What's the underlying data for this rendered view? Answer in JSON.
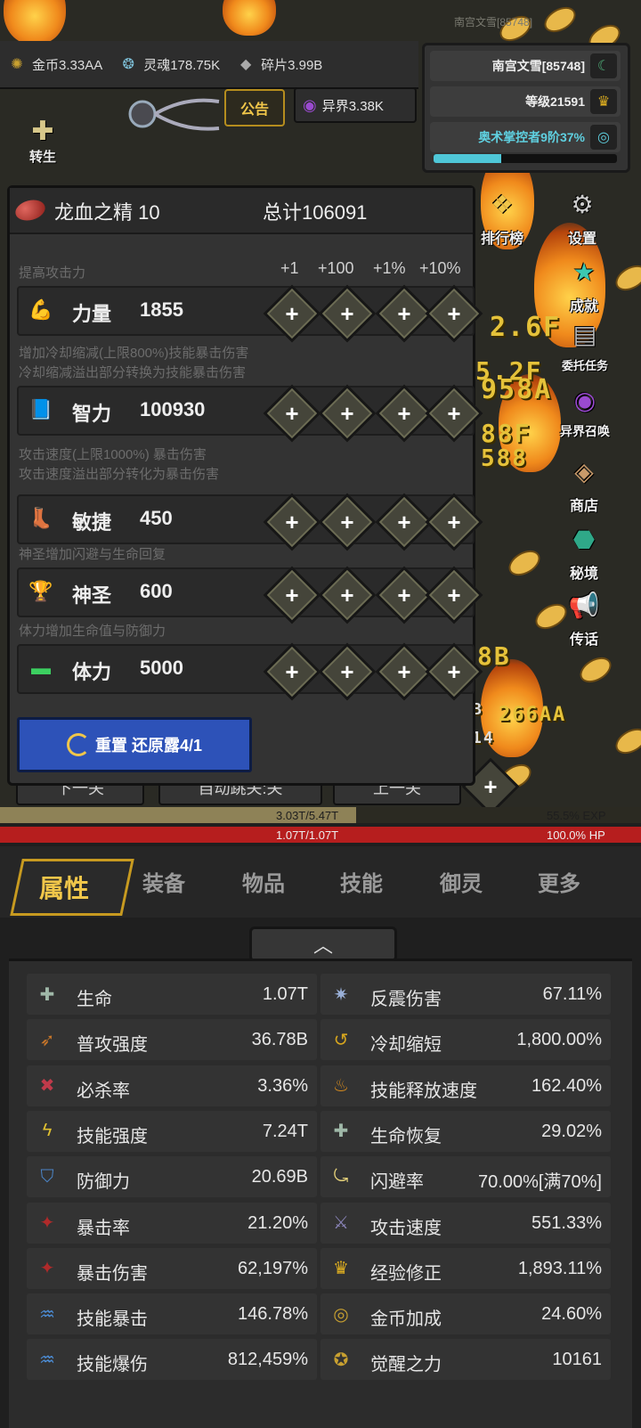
{
  "player": {
    "name_top": "南宫文雪[85748]",
    "name": "南宫文雪[85748]",
    "level": "等级21591",
    "tier": "奥术掌控者9阶37%",
    "tier_progress": 0.37
  },
  "currencies": [
    {
      "icon": "gold-coin-icon",
      "label": "金币3.33AA"
    },
    {
      "icon": "soul-icon",
      "label": "灵魂178.75K"
    },
    {
      "icon": "shard-icon",
      "label": "碎片3.99B"
    }
  ],
  "notice": "公告",
  "otherworld": "异界3.38K",
  "rebirth": "转生",
  "side_menu": [
    "排行榜",
    "设置",
    "成就",
    "委托任务",
    "异界召唤",
    "商店",
    "秘境",
    "传话"
  ],
  "battle_numbers": [
    "2.6F",
    "5.2F",
    "958A",
    "88F",
    "8B",
    "266AA",
    "588",
    "B",
    "14"
  ],
  "modal": {
    "potion_name": "龙血之精 10",
    "potion_total": "总计106091",
    "steps": [
      "+1",
      "+100",
      "+1%",
      "+10%"
    ],
    "sections": [
      {
        "desc": [
          "提高攻击力"
        ],
        "icon": "strength-arm-icon",
        "name": "力量",
        "value": "1855"
      },
      {
        "desc": [
          "增加冷却缩减(上限800%)技能暴击伤害",
          "冷却缩减溢出部分转换为技能暴击伤害"
        ],
        "icon": "book-icon",
        "name": "智力",
        "value": "100930"
      },
      {
        "desc": [
          "攻击速度(上限1000%) 暴击伤害",
          "攻击速度溢出部分转化为暴击伤害"
        ],
        "icon": "boot-icon",
        "name": "敏捷",
        "value": "450"
      },
      {
        "desc": [
          "神圣增加闪避与生命回复"
        ],
        "icon": "trophy-icon",
        "name": "神圣",
        "value": "600"
      },
      {
        "desc": [
          "体力增加生命值与防御力"
        ],
        "icon": "bone-icon",
        "name": "体力",
        "value": "5000"
      }
    ],
    "reset_label": "重置 还原露4/1",
    "hidden_buttons": [
      "下一关",
      "自动跳关:关",
      "上一关"
    ]
  },
  "exp": {
    "text": "3.03T/5.47T",
    "percent": "55.5% EXP",
    "fill": 0.555
  },
  "hp": {
    "text": "1.07T/1.07T",
    "percent": "100.0%  HP",
    "fill": 1.0
  },
  "tabs": [
    "属性",
    "装备",
    "物品",
    "技能",
    "御灵",
    "更多"
  ],
  "collapse_icon": "chevron-up-icon",
  "attributes": [
    {
      "icon": "life-icon",
      "name": "生命",
      "value": "1.07T",
      "color": "#9fb8a8"
    },
    {
      "icon": "reflect-icon",
      "name": "反震伤害",
      "value": "67.11%",
      "color": "#9ab0d8"
    },
    {
      "icon": "attack-power-icon",
      "name": "普攻强度",
      "value": "36.78B",
      "color": "#c8762a"
    },
    {
      "icon": "cooldown-icon",
      "name": "冷却缩短",
      "value": "1,800.00%",
      "color": "#d6a51e"
    },
    {
      "icon": "kill-rate-icon",
      "name": "必杀率",
      "value": "3.36%",
      "color": "#c03a4a"
    },
    {
      "icon": "cast-speed-icon",
      "name": "技能释放速度",
      "value": "162.40%",
      "color": "#d58a1e"
    },
    {
      "icon": "skill-power-icon",
      "name": "技能强度",
      "value": "7.24T",
      "color": "#e0c030"
    },
    {
      "icon": "regen-icon",
      "name": "生命恢复",
      "value": "29.02%",
      "color": "#9fb8a8"
    },
    {
      "icon": "shield-icon",
      "name": "防御力",
      "value": "20.69B",
      "color": "#4c86c8"
    },
    {
      "icon": "dodge-icon",
      "name": "闪避率",
      "value": "70.00%[满70%]",
      "color": "#e6d27a"
    },
    {
      "icon": "crit-rate-icon",
      "name": "暴击率",
      "value": "21.20%",
      "color": "#b02a2a"
    },
    {
      "icon": "attack-speed-icon",
      "name": "攻击速度",
      "value": "551.33%",
      "color": "#8a84b8"
    },
    {
      "icon": "crit-damage-icon",
      "name": "暴击伤害",
      "value": "62,197%",
      "color": "#b02a2a"
    },
    {
      "icon": "crown-icon",
      "name": "经验修正",
      "value": "1,893.11%",
      "color": "#e0b020"
    },
    {
      "icon": "skill-crit-icon",
      "name": "技能暴击",
      "value": "146.78%",
      "color": "#4c8ed8"
    },
    {
      "icon": "gold-bonus-icon",
      "name": "金币加成",
      "value": "24.60%",
      "color": "#c8a030"
    },
    {
      "icon": "skill-crit-dmg-icon",
      "name": "技能爆伤",
      "value": "812,459%",
      "color": "#4c8ed8"
    },
    {
      "icon": "awaken-icon",
      "name": "觉醒之力",
      "value": "10161",
      "color": "#c8a030"
    }
  ]
}
